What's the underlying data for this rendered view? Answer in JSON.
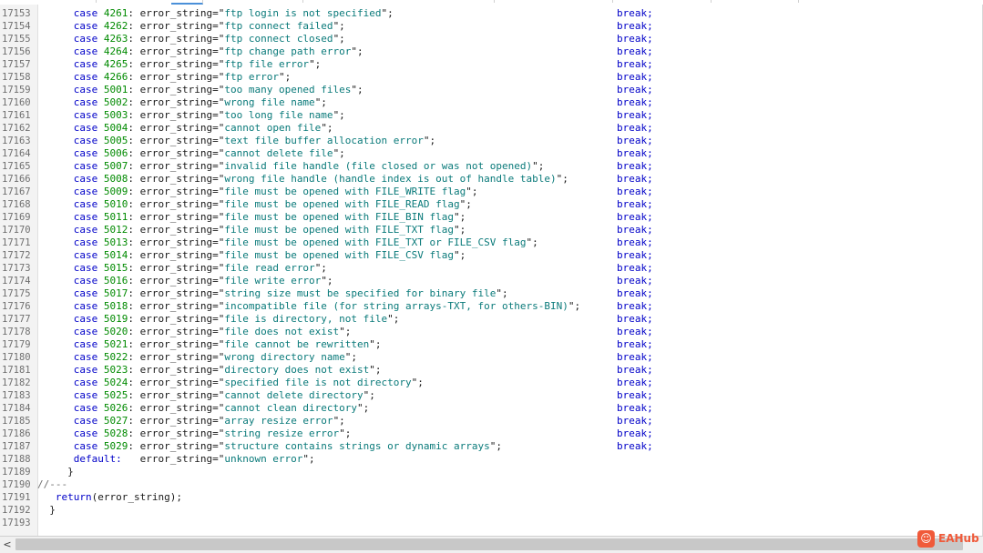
{
  "editor": {
    "lines": [
      {
        "num": "17153",
        "indent": "      ",
        "code": "4261",
        "msg": "ftp login is not specified"
      },
      {
        "num": "17154",
        "indent": "      ",
        "code": "4262",
        "msg": "ftp connect failed"
      },
      {
        "num": "17155",
        "indent": "      ",
        "code": "4263",
        "msg": "ftp connect closed"
      },
      {
        "num": "17156",
        "indent": "      ",
        "code": "4264",
        "msg": "ftp change path error"
      },
      {
        "num": "17157",
        "indent": "      ",
        "code": "4265",
        "msg": "ftp file error"
      },
      {
        "num": "17158",
        "indent": "      ",
        "code": "4266",
        "msg": "ftp error"
      },
      {
        "num": "17159",
        "indent": "      ",
        "code": "5001",
        "msg": "too many opened files"
      },
      {
        "num": "17160",
        "indent": "      ",
        "code": "5002",
        "msg": "wrong file name"
      },
      {
        "num": "17161",
        "indent": "      ",
        "code": "5003",
        "msg": "too long file name"
      },
      {
        "num": "17162",
        "indent": "      ",
        "code": "5004",
        "msg": "cannot open file"
      },
      {
        "num": "17163",
        "indent": "      ",
        "code": "5005",
        "msg": "text file buffer allocation error"
      },
      {
        "num": "17164",
        "indent": "      ",
        "code": "5006",
        "msg": "cannot delete file"
      },
      {
        "num": "17165",
        "indent": "      ",
        "code": "5007",
        "msg": "invalid file handle (file closed or was not opened)"
      },
      {
        "num": "17166",
        "indent": "      ",
        "code": "5008",
        "msg": "wrong file handle (handle index is out of handle table)"
      },
      {
        "num": "17167",
        "indent": "      ",
        "code": "5009",
        "msg": "file must be opened with FILE_WRITE flag"
      },
      {
        "num": "17168",
        "indent": "      ",
        "code": "5010",
        "msg": "file must be opened with FILE_READ flag"
      },
      {
        "num": "17169",
        "indent": "      ",
        "code": "5011",
        "msg": "file must be opened with FILE_BIN flag"
      },
      {
        "num": "17170",
        "indent": "      ",
        "code": "5012",
        "msg": "file must be opened with FILE_TXT flag"
      },
      {
        "num": "17171",
        "indent": "      ",
        "code": "5013",
        "msg": "file must be opened with FILE_TXT or FILE_CSV flag"
      },
      {
        "num": "17172",
        "indent": "      ",
        "code": "5014",
        "msg": "file must be opened with FILE_CSV flag"
      },
      {
        "num": "17173",
        "indent": "      ",
        "code": "5015",
        "msg": "file read error"
      },
      {
        "num": "17174",
        "indent": "      ",
        "code": "5016",
        "msg": "file write error"
      },
      {
        "num": "17175",
        "indent": "      ",
        "code": "5017",
        "msg": "string size must be specified for binary file"
      },
      {
        "num": "17176",
        "indent": "      ",
        "code": "5018",
        "msg": "incompatible file (for string arrays-TXT, for others-BIN)"
      },
      {
        "num": "17177",
        "indent": "      ",
        "code": "5019",
        "msg": "file is directory, not file"
      },
      {
        "num": "17178",
        "indent": "      ",
        "code": "5020",
        "msg": "file does not exist"
      },
      {
        "num": "17179",
        "indent": "      ",
        "code": "5021",
        "msg": "file cannot be rewritten"
      },
      {
        "num": "17180",
        "indent": "      ",
        "code": "5022",
        "msg": "wrong directory name"
      },
      {
        "num": "17181",
        "indent": "      ",
        "code": "5023",
        "msg": "directory does not exist"
      },
      {
        "num": "17182",
        "indent": "      ",
        "code": "5024",
        "msg": "specified file is not directory"
      },
      {
        "num": "17183",
        "indent": "      ",
        "code": "5025",
        "msg": "cannot delete directory"
      },
      {
        "num": "17184",
        "indent": "      ",
        "code": "5026",
        "msg": "cannot clean directory"
      },
      {
        "num": "17185",
        "indent": "      ",
        "code": "5027",
        "msg": "array resize error"
      },
      {
        "num": "17186",
        "indent": "      ",
        "code": "5028",
        "msg": "string resize error"
      },
      {
        "num": "17187",
        "indent": "      ",
        "code": "5029",
        "msg": "structure contains strings or dynamic arrays"
      }
    ],
    "default_line": {
      "num": "17188",
      "text": "      default:   error_string=\"unknown error\";"
    },
    "tail_lines": [
      {
        "num": "17189",
        "text": "     }"
      },
      {
        "num": "17190",
        "text": "//---"
      },
      {
        "num": "17191",
        "text": "   return(error_string);"
      },
      {
        "num": "17192",
        "text": "  }"
      },
      {
        "num": "17193",
        "text": ""
      }
    ],
    "case_kw": "case",
    "assign": "error_string=",
    "break_kw": "break;"
  },
  "scrollbar": {
    "left_arrow": "<"
  },
  "watermark": {
    "text": "EAHub",
    "logo_glyph": "☺"
  },
  "colors": {
    "keyword": "#0000c8",
    "number": "#008a00",
    "string": "#0a7a7a",
    "comment": "#707070",
    "watermark": "#f05a3a"
  }
}
